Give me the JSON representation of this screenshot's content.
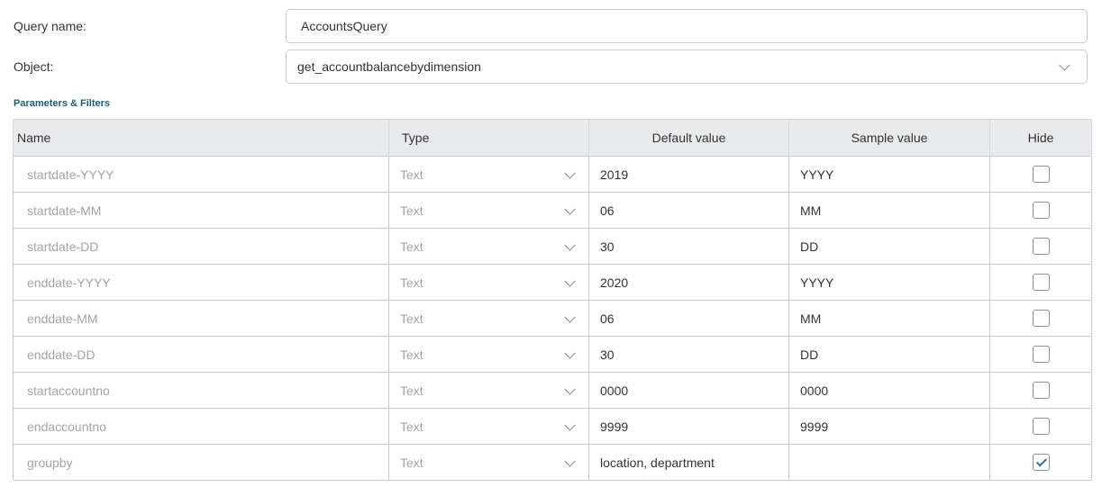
{
  "form": {
    "query_name_label": "Query name:",
    "query_name_value": "AccountsQuery",
    "object_label": "Object:",
    "object_value": "get_accountbalancebydimension",
    "object_icon": "chevron-down-icon"
  },
  "section_title": "Parameters & Filters",
  "table": {
    "headers": {
      "name": "Name",
      "type": "Type",
      "default": "Default value",
      "sample": "Sample value",
      "hide": "Hide"
    },
    "rows": [
      {
        "name": "startdate-YYYY",
        "type": "Text",
        "default": "2019",
        "sample": "YYYY",
        "hide": false
      },
      {
        "name": "startdate-MM",
        "type": "Text",
        "default": "06",
        "sample": "MM",
        "hide": false
      },
      {
        "name": "startdate-DD",
        "type": "Text",
        "default": "30",
        "sample": "DD",
        "hide": false
      },
      {
        "name": "enddate-YYYY",
        "type": "Text",
        "default": "2020",
        "sample": "YYYY",
        "hide": false
      },
      {
        "name": "enddate-MM",
        "type": "Text",
        "default": "06",
        "sample": "MM",
        "hide": false
      },
      {
        "name": "enddate-DD",
        "type": "Text",
        "default": "30",
        "sample": "DD",
        "hide": false
      },
      {
        "name": "startaccountno",
        "type": "Text",
        "default": "0000",
        "sample": "0000",
        "hide": false
      },
      {
        "name": "endaccountno",
        "type": "Text",
        "default": "9999",
        "sample": "9999",
        "hide": false
      },
      {
        "name": "groupby",
        "type": "Text",
        "default": "location, department",
        "sample": "",
        "hide": true
      }
    ]
  },
  "colors": {
    "section_title": "#1c5f73",
    "header_bg": "#e8eaec",
    "muted_text": "#a0a5aa",
    "check": "#2a6db5"
  }
}
